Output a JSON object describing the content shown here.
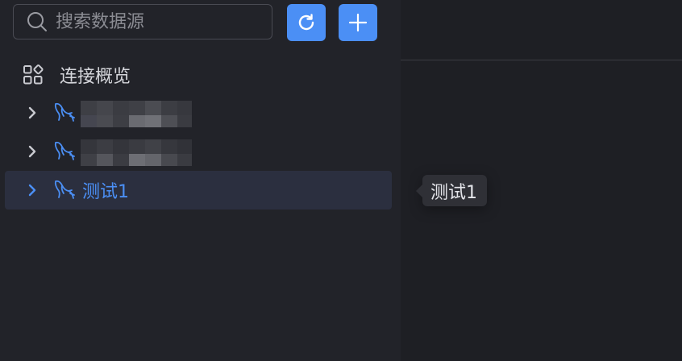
{
  "search": {
    "placeholder": "搜索数据源",
    "value": ""
  },
  "toolbar": {
    "refresh_icon": "refresh-icon",
    "add_icon": "plus-icon"
  },
  "overview": {
    "label": "连接概览",
    "icon": "grid-icon"
  },
  "tree": {
    "items": [
      {
        "label": "",
        "redacted": true,
        "icon": "mysql-dolphin-icon",
        "active": false
      },
      {
        "label": "",
        "redacted": true,
        "icon": "mysql-dolphin-icon",
        "active": false
      },
      {
        "label": "测试1",
        "redacted": false,
        "icon": "mysql-dolphin-icon",
        "active": true
      }
    ]
  },
  "tooltip": {
    "text": "测试1"
  },
  "colors": {
    "accent": "#4b8ff5",
    "sidebar_bg": "#222329",
    "main_bg": "#1e1f24",
    "active_row_bg": "#2b2f3f",
    "text": "#d6d7dc"
  }
}
